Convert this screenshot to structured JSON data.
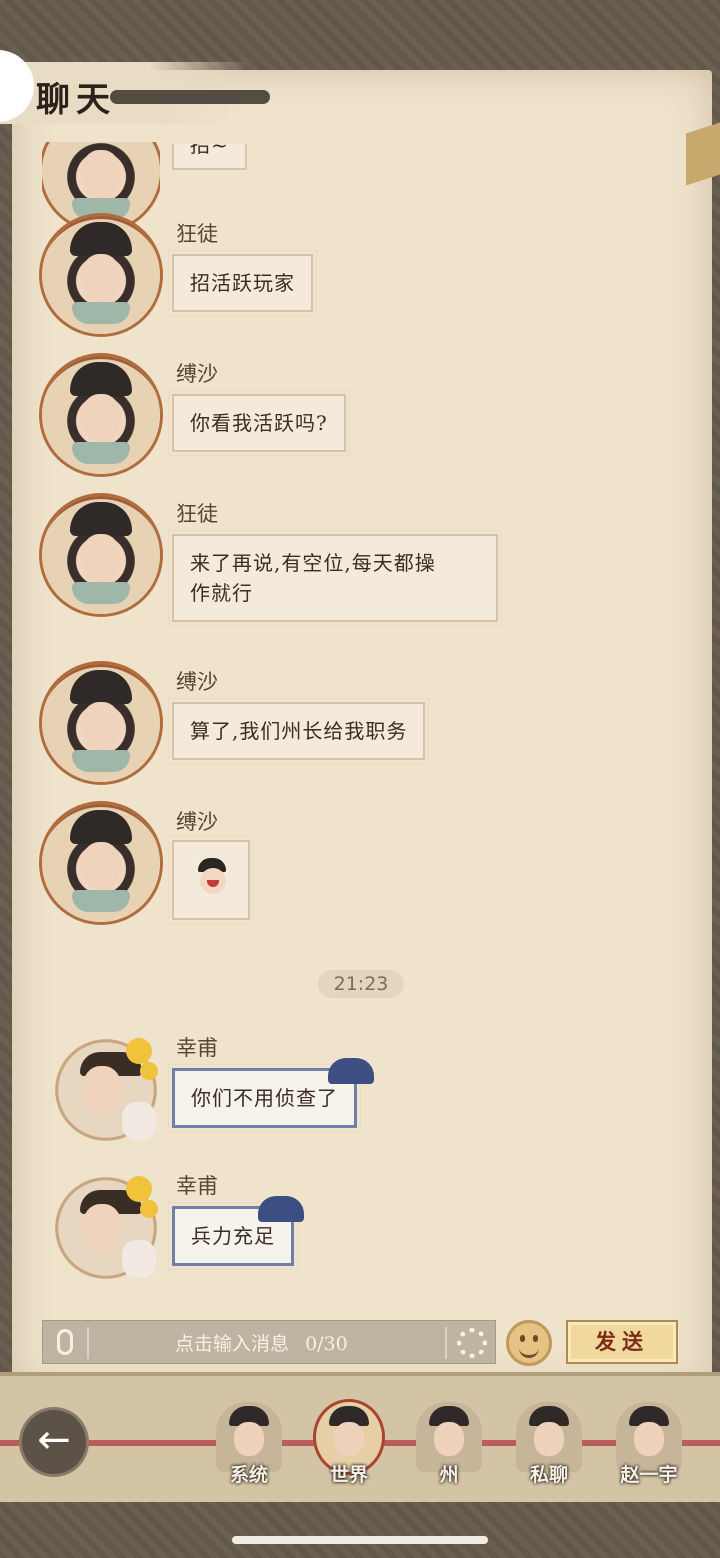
{
  "header": {
    "title": "聊天"
  },
  "messages": [
    {
      "sender": "",
      "text": "招~",
      "type": "text"
    },
    {
      "sender": "狂徒",
      "text": "招活跃玩家",
      "type": "text"
    },
    {
      "sender": "缚沙",
      "text": "你看我活跃吗?",
      "type": "text"
    },
    {
      "sender": "狂徒",
      "text": "来了再说,有空位,每天都操作就行",
      "line1": "来了再说,有空位,每天都操",
      "line2": "作就行",
      "type": "text"
    },
    {
      "sender": "缚沙",
      "text": "算了,我们州长给我职务",
      "type": "text"
    },
    {
      "sender": "缚沙",
      "text": "",
      "type": "emoji",
      "emoji": "smiling-character-emoji"
    },
    {
      "sender": "幸甫",
      "text": "你们不用侦查了",
      "type": "text",
      "style": "blue"
    },
    {
      "sender": "幸甫",
      "text": "兵力充足",
      "type": "text",
      "style": "blue"
    }
  ],
  "timestamp": "21:23",
  "composer": {
    "placeholder": "点击输入消息",
    "counter": "0/30",
    "send_label": "发送"
  },
  "tabs": [
    {
      "label": "系统",
      "active": false
    },
    {
      "label": "世界",
      "active": true
    },
    {
      "label": "州",
      "active": false
    },
    {
      "label": "私聊",
      "active": false
    },
    {
      "label": "赵一宇",
      "active": false
    }
  ],
  "colors": {
    "paper": "#efe3cc",
    "accent_red": "#a9452f",
    "bubble_blue": "#6f7fa8",
    "send_gold": "#f1d89c"
  }
}
